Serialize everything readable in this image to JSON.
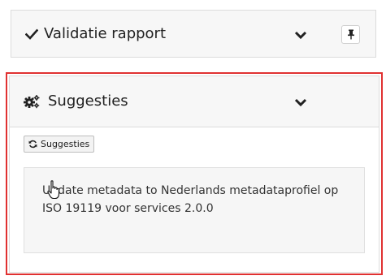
{
  "validation_panel": {
    "title": "Validatie rapport",
    "icons": {
      "title": "check-icon",
      "toggle": "chevron-down-icon",
      "pin": "pin-icon"
    }
  },
  "suggestions_panel": {
    "title": "Suggesties",
    "refresh_label": "Suggesties",
    "items": [
      "Update metadata to Nederlands metadataprofiel op ISO 19119 voor services 2.0.0"
    ],
    "icons": {
      "title": "gears-icon",
      "toggle": "chevron-down-icon",
      "refresh": "refresh-icon"
    }
  },
  "colors": {
    "highlight": "#e03131",
    "panel_bg": "#f7f7f7",
    "card_bg": "#f6f6f6"
  }
}
